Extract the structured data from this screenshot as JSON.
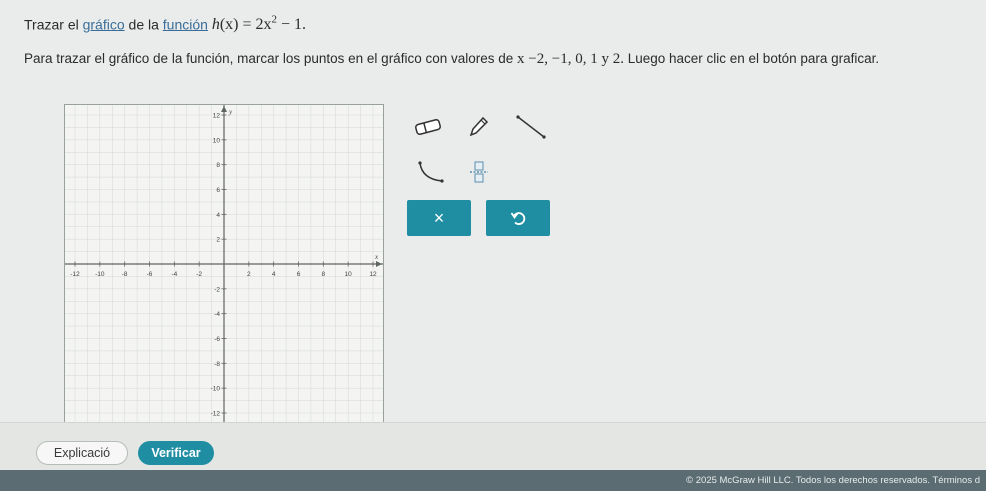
{
  "question": {
    "line1_prefix": "Trazar el",
    "link_grafico": "gráfico",
    "line1_mid": "de la",
    "link_funcion": "función",
    "func_name": "h",
    "func_arg": "(x)",
    "func_eq": " = 2x",
    "func_exp": "2",
    "func_tail": " − 1.",
    "line2_prefix": "Para trazar el gráfico de la función, marcar los puntos en el gráfico con valores de",
    "x_values": "x −2, −1, 0, 1 y 2.",
    "line2_suffix": "Luego hacer clic en el botón para graficar."
  },
  "graph": {
    "x_axis_label": "x",
    "y_axis_label": "y",
    "x_range": [
      -12,
      12
    ],
    "y_range": [
      -12,
      12
    ],
    "x_ticks": [
      "-12",
      "-10",
      "-8",
      "-6",
      "-4",
      "-2",
      "2",
      "4",
      "6",
      "8",
      "10",
      "12"
    ],
    "y_ticks": [
      "12",
      "10",
      "8",
      "6",
      "4",
      "2",
      "-2",
      "-4",
      "-6",
      "-8",
      "-10",
      "-12"
    ],
    "colors": {
      "background": "#f4f5f3",
      "grid": "#d3d7d4",
      "axis": "#5f6561"
    }
  },
  "tools": {
    "eraser": "eraser-icon",
    "pencil": "pencil-icon",
    "line": "line-tool-icon",
    "curve": "curve-tool-icon",
    "fraction": "fraction-icon",
    "clear_symbol": "×",
    "undo": "undo-icon"
  },
  "buttons": {
    "explanation": "Explicació",
    "verify": "Verificar"
  },
  "footer": {
    "text": "© 2025 McGraw Hill LLC. Todos los derechos reservados.   Términos d"
  }
}
